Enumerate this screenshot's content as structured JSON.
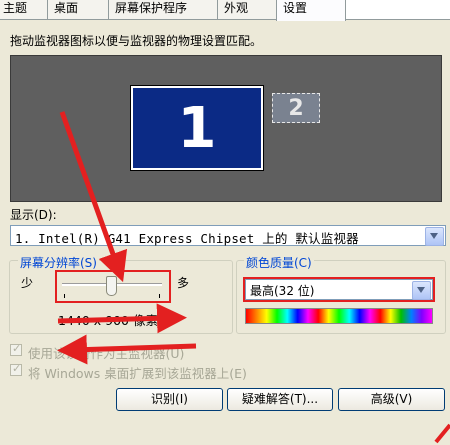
{
  "tabs": [
    {
      "label": "主题"
    },
    {
      "label": "桌面"
    },
    {
      "label": "屏幕保护程序"
    },
    {
      "label": "外观"
    },
    {
      "label": "设置",
      "active": true
    }
  ],
  "instruction": "拖动监视器图标以便与监视器的物理设置匹配。",
  "monitors": {
    "primary": "1",
    "secondary": "2"
  },
  "display": {
    "label": "显示(D):",
    "selected": "1. Intel(R) G41 Express Chipset 上的 默认监视器"
  },
  "resolution": {
    "title": "屏幕分辨率(S)",
    "less_label": "少",
    "more_label": "多",
    "value": "1440 x 900 像素"
  },
  "color_quality": {
    "title": "颜色质量(C)",
    "selected": "最高(32 位)"
  },
  "checkboxes": [
    {
      "label": "使用该设备作为主监视器(U)",
      "checked": true,
      "enabled": false
    },
    {
      "label": "将 Windows 桌面扩展到该监视器上(E)",
      "checked": true,
      "enabled": false
    }
  ],
  "buttons": {
    "identify": "识别(I)",
    "troubleshoot": "疑难解答(T)...",
    "advanced": "高级(V)"
  },
  "colors": {
    "window_bg": "#ece9d8",
    "monitor_primary": "#0b2a85",
    "canvas": "#5f5f5f",
    "annotation_red": "#e32020",
    "group_title": "#0046d5"
  }
}
